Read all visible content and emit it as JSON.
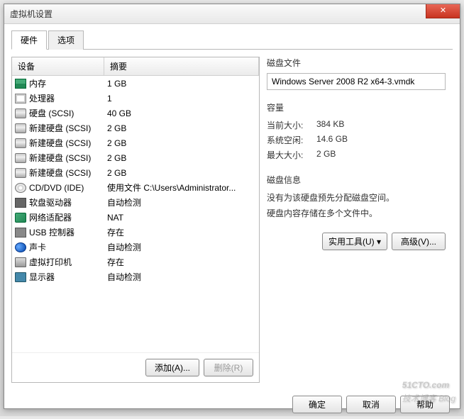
{
  "window": {
    "title": "虚拟机设置",
    "close": "✕"
  },
  "tabs": {
    "hardware": "硬件",
    "options": "选项"
  },
  "list": {
    "header_device": "设备",
    "header_summary": "摘要",
    "items": [
      {
        "icon": "memory",
        "name": "内存",
        "summary": "1 GB"
      },
      {
        "icon": "cpu",
        "name": "处理器",
        "summary": "1"
      },
      {
        "icon": "disk",
        "name": "硬盘 (SCSI)",
        "summary": "40 GB"
      },
      {
        "icon": "disk",
        "name": "新建硬盘 (SCSI)",
        "summary": "2 GB"
      },
      {
        "icon": "disk",
        "name": "新建硬盘 (SCSI)",
        "summary": "2 GB"
      },
      {
        "icon": "disk",
        "name": "新建硬盘 (SCSI)",
        "summary": "2 GB"
      },
      {
        "icon": "disk",
        "name": "新建硬盘 (SCSI)",
        "summary": "2 GB"
      },
      {
        "icon": "cd",
        "name": "CD/DVD (IDE)",
        "summary": "使用文件 C:\\Users\\Administrator..."
      },
      {
        "icon": "floppy",
        "name": "软盘驱动器",
        "summary": "自动检测"
      },
      {
        "icon": "network",
        "name": "网络适配器",
        "summary": "NAT"
      },
      {
        "icon": "usb",
        "name": "USB 控制器",
        "summary": "存在"
      },
      {
        "icon": "sound",
        "name": "声卡",
        "summary": "自动检测"
      },
      {
        "icon": "printer",
        "name": "虚拟打印机",
        "summary": "存在"
      },
      {
        "icon": "display",
        "name": "显示器",
        "summary": "自动检测"
      }
    ],
    "add_btn": "添加(A)...",
    "remove_btn": "删除(R)"
  },
  "detail": {
    "disk_file_title": "磁盘文件",
    "disk_file_value": "Windows Server 2008 R2 x64-3.vmdk",
    "capacity_title": "容量",
    "current_size_label": "当前大小:",
    "current_size_value": "384 KB",
    "free_space_label": "系统空闲:",
    "free_space_value": "14.6 GB",
    "max_size_label": "最大大小:",
    "max_size_value": "2 GB",
    "disk_info_title": "磁盘信息",
    "disk_info_line1": "没有为该硬盘预先分配磁盘空间。",
    "disk_info_line2": "硬盘内容存储在多个文件中。",
    "utilities_btn": "实用工具(U)",
    "advanced_btn": "高级(V)..."
  },
  "footer": {
    "ok": "确定",
    "cancel": "取消",
    "help": "帮助"
  },
  "watermark": {
    "main": "51CTO.com",
    "sub": "技术博客 Blog"
  }
}
